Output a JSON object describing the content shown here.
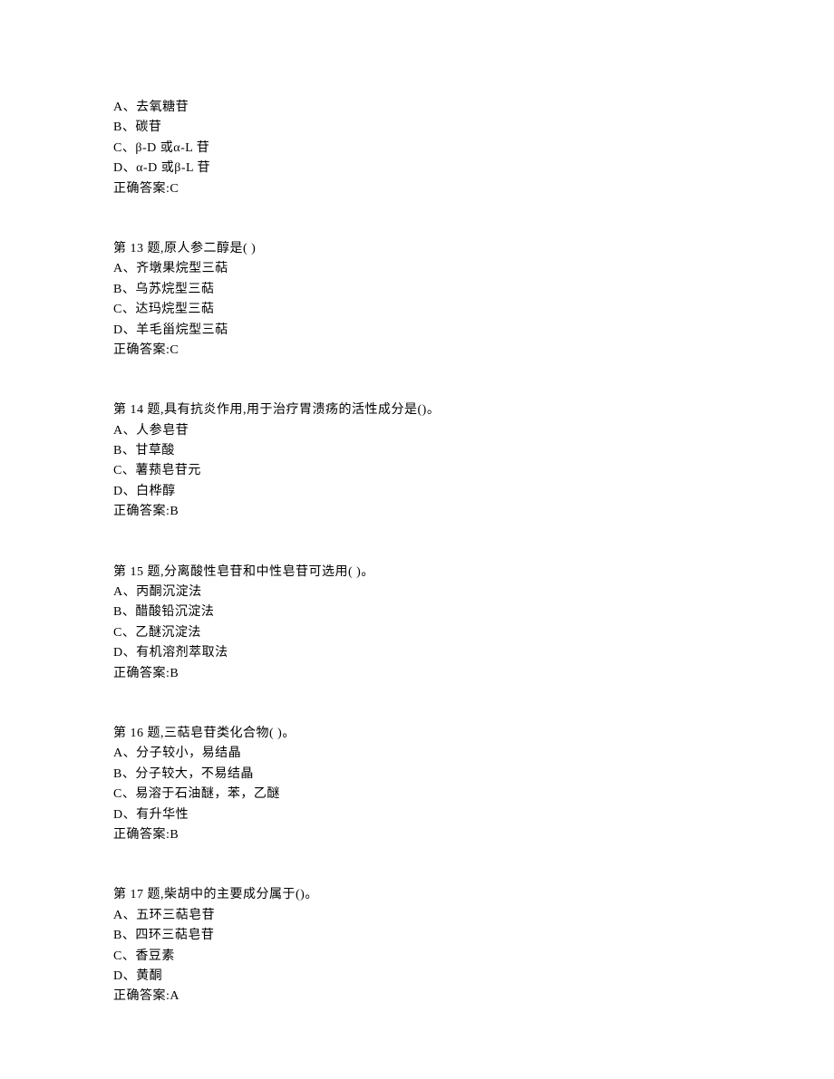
{
  "blocks": [
    {
      "lines": [
        "A、去氧糖苷",
        "B、碳苷",
        "C、β-D 或α-L 苷",
        "D、α-D 或β-L 苷",
        "正确答案:C"
      ]
    },
    {
      "lines": [
        "第 13 题,原人参二醇是(  )",
        "A、齐墩果烷型三萜",
        "B、乌苏烷型三萜",
        "C、达玛烷型三萜",
        "D、羊毛甾烷型三萜",
        "正确答案:C"
      ]
    },
    {
      "lines": [
        "第 14 题,具有抗炎作用,用于治疗胃溃疡的活性成分是()。",
        "A、人参皂苷",
        "B、甘草酸",
        "C、薯蓣皂苷元",
        "D、白桦醇",
        "正确答案:B"
      ]
    },
    {
      "lines": [
        "第 15 题,分离酸性皂苷和中性皂苷可选用(  )。",
        "A、丙酮沉淀法",
        "B、醋酸铅沉淀法",
        "C、乙醚沉淀法",
        "D、有机溶剂萃取法",
        "正确答案:B"
      ]
    },
    {
      "lines": [
        "第 16 题,三萜皂苷类化合物(  )。",
        "A、分子较小，易结晶",
        "B、分子较大，不易结晶",
        "C、易溶于石油醚，苯，乙醚",
        "D、有升华性",
        "正确答案:B"
      ]
    },
    {
      "lines": [
        "第 17 题,柴胡中的主要成分属于()。",
        "A、五环三萜皂苷",
        "B、四环三萜皂苷",
        "C、香豆素",
        "D、黄酮",
        "正确答案:A"
      ]
    }
  ]
}
